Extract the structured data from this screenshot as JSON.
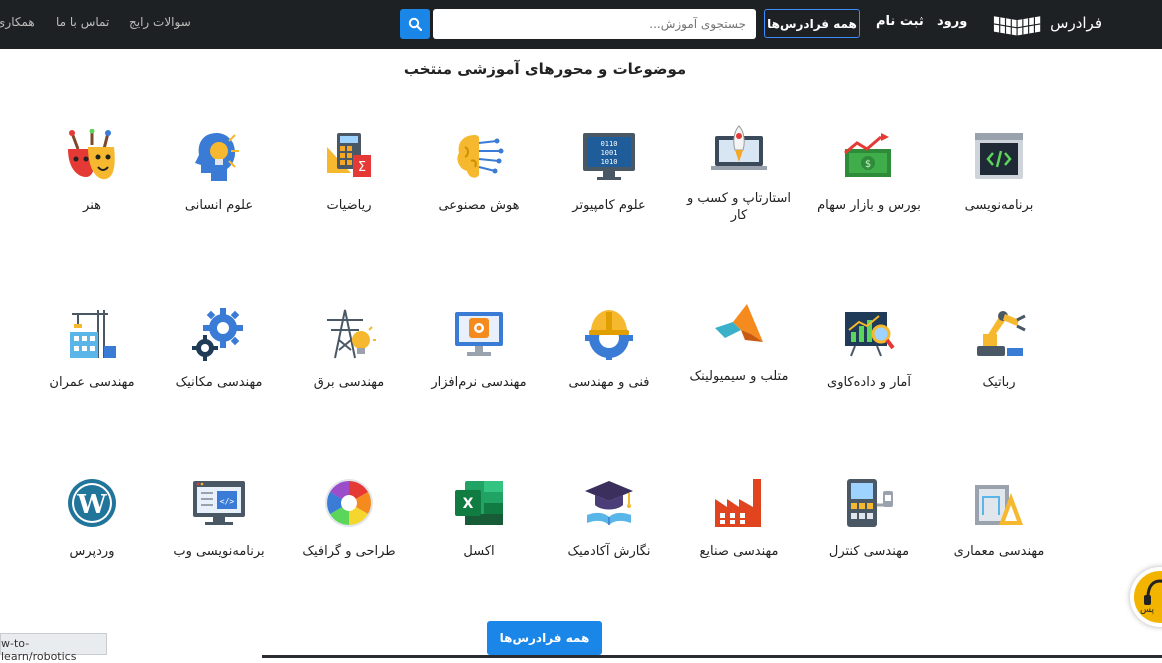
{
  "header": {
    "brand": "فرادرس",
    "login": "ورود",
    "signup": "ثبت نام",
    "all_courses": "همه فرادرس‌ها",
    "search_placeholder": "جستجوی آموزش...",
    "links": [
      "سوالات رایج",
      "تماس با ما",
      "همکاری"
    ]
  },
  "section_title": "موضوعات و محورهای آموزشی منتخب",
  "categories": [
    {
      "label": "برنامه‌نویسی",
      "icon": "code-monitor-icon"
    },
    {
      "label": "بورس و بازار سهام",
      "icon": "stock-market-icon"
    },
    {
      "label": "استارتاپ و کسب و کار",
      "icon": "startup-rocket-icon"
    },
    {
      "label": "علوم کامپیوتر",
      "icon": "binary-monitor-icon"
    },
    {
      "label": "هوش مصنوعی",
      "icon": "ai-brain-icon"
    },
    {
      "label": "ریاضیات",
      "icon": "calculator-icon"
    },
    {
      "label": "علوم انسانی",
      "icon": "head-bulb-icon"
    },
    {
      "label": "هنر",
      "icon": "art-masks-icon"
    },
    {
      "label": "رباتیک",
      "icon": "robot-arm-icon"
    },
    {
      "label": "آمار و داده‌کاوی",
      "icon": "data-chart-icon"
    },
    {
      "label": "متلب و سیمیولینک",
      "icon": "matlab-icon"
    },
    {
      "label": "فنی و مهندسی",
      "icon": "engineering-gear-icon"
    },
    {
      "label": "مهندسی نرم‌افزار",
      "icon": "software-monitor-icon"
    },
    {
      "label": "مهندسی برق",
      "icon": "power-tower-icon"
    },
    {
      "label": "مهندسی مکانیک",
      "icon": "gears-icon"
    },
    {
      "label": "مهندسی عمران",
      "icon": "crane-building-icon"
    },
    {
      "label": "مهندسی معماری",
      "icon": "architecture-icon"
    },
    {
      "label": "مهندسی کنترل",
      "icon": "control-panel-icon"
    },
    {
      "label": "مهندسی صنایع",
      "icon": "factory-icon"
    },
    {
      "label": "نگارش آکادمیک",
      "icon": "graduation-cap-icon"
    },
    {
      "label": "اکسل",
      "icon": "excel-icon"
    },
    {
      "label": "طراحی و گرافیک",
      "icon": "color-wheel-icon"
    },
    {
      "label": "برنامه‌نویسی وب",
      "icon": "web-code-icon"
    },
    {
      "label": "وردپرس",
      "icon": "wordpress-icon"
    }
  ],
  "bottom_button": "همه فرادرس‌ها",
  "status_url": "w-to-learn/robotics",
  "support_label": "پس",
  "colors": {
    "topbar": "#1e2124",
    "accent": "#1a86e8"
  }
}
